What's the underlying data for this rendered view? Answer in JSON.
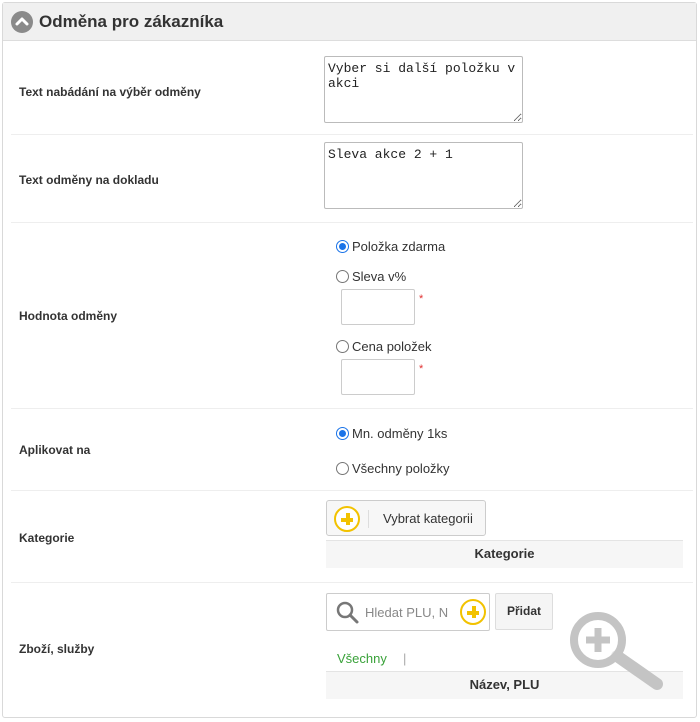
{
  "panel": {
    "title": "Odměna pro zákazníka"
  },
  "fields": {
    "prompt_text": {
      "label": "Text nabádání na výběr odměny",
      "value": "Vyber si další položku v akci"
    },
    "receipt_text": {
      "label": "Text odměny na dokladu",
      "value": "Sleva akce 2 + 1"
    },
    "reward_value": {
      "label": "Hodnota odměny",
      "options": [
        {
          "label": "Položka zdarma",
          "checked": true
        },
        {
          "label": "Sleva v%",
          "checked": false
        },
        {
          "label": "Cena položek",
          "checked": false
        }
      ],
      "required_mark": "*"
    },
    "apply_to": {
      "label": "Aplikovat na",
      "options": [
        {
          "label": "Mn. odměny 1ks",
          "checked": true
        },
        {
          "label": "Všechny položky",
          "checked": false
        }
      ]
    },
    "category": {
      "label": "Kategorie",
      "button_label": "Vybrat kategorii",
      "column_header": "Kategorie"
    },
    "products": {
      "label": "Zboží, služby",
      "search_placeholder": "Hledat PLU, N",
      "add_button": "Přidat",
      "filter_all": "Všechny",
      "filter_separator": "|",
      "column_header": "Název, PLU"
    }
  },
  "colors": {
    "accent_yellow": "#f2c200",
    "radio_blue": "#1a73e8",
    "link_green": "#3aa23a",
    "required_red": "#e03030"
  },
  "icons": {
    "collapse": "chevron-up-icon",
    "add": "plus-circle-icon",
    "search": "magnifier-icon",
    "zoom": "zoom-in-icon"
  }
}
